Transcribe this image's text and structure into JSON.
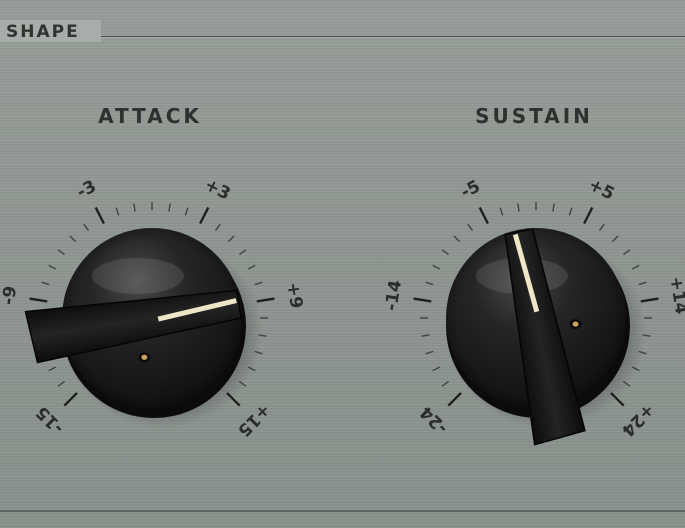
{
  "section": {
    "title": "SHAPE"
  },
  "knobs": [
    {
      "title": "ATTACK",
      "value": 9,
      "labels": [
        "-15",
        "-9",
        "-3",
        "+3",
        "+9",
        "+15"
      ]
    },
    {
      "title": "SUSTAIN",
      "value": -2,
      "labels": [
        "-24",
        "-14",
        "-5",
        "+5",
        "+14",
        "+24"
      ]
    }
  ],
  "colors": {
    "panel": "#8e9590",
    "knob": "#1a1a1a",
    "indicator": "#efe6c8",
    "text": "#2d322f"
  }
}
